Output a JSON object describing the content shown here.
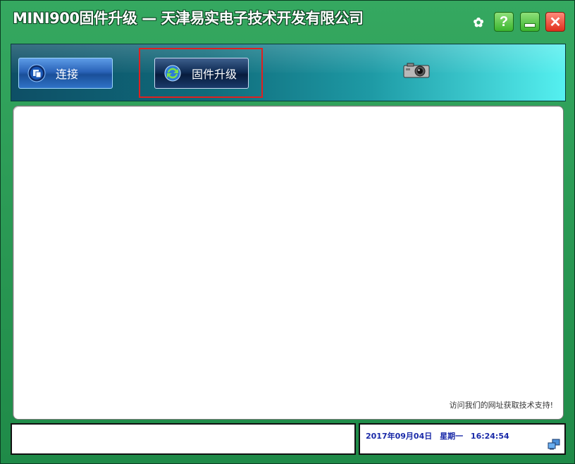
{
  "window": {
    "title": "MINI900固件升级 — 天津易实电子技术开发有限公司"
  },
  "titlebar_buttons": {
    "settings_icon": "gear-icon",
    "help_label": "?",
    "minimize_icon": "minimize-icon",
    "close_label": "✕"
  },
  "toolbar": {
    "connect_label": "连接",
    "upgrade_label": "固件升级",
    "camera_icon": "camera-icon"
  },
  "log": {
    "support_text": "访问我们的网址获取技术支持!"
  },
  "status": {
    "date": "2017年09月04日",
    "weekday": "星期一",
    "time": "16:24:54"
  },
  "colors": {
    "frame": "#2a9a55",
    "highlight": "#e02020",
    "datetime": "#1a2aa8"
  }
}
